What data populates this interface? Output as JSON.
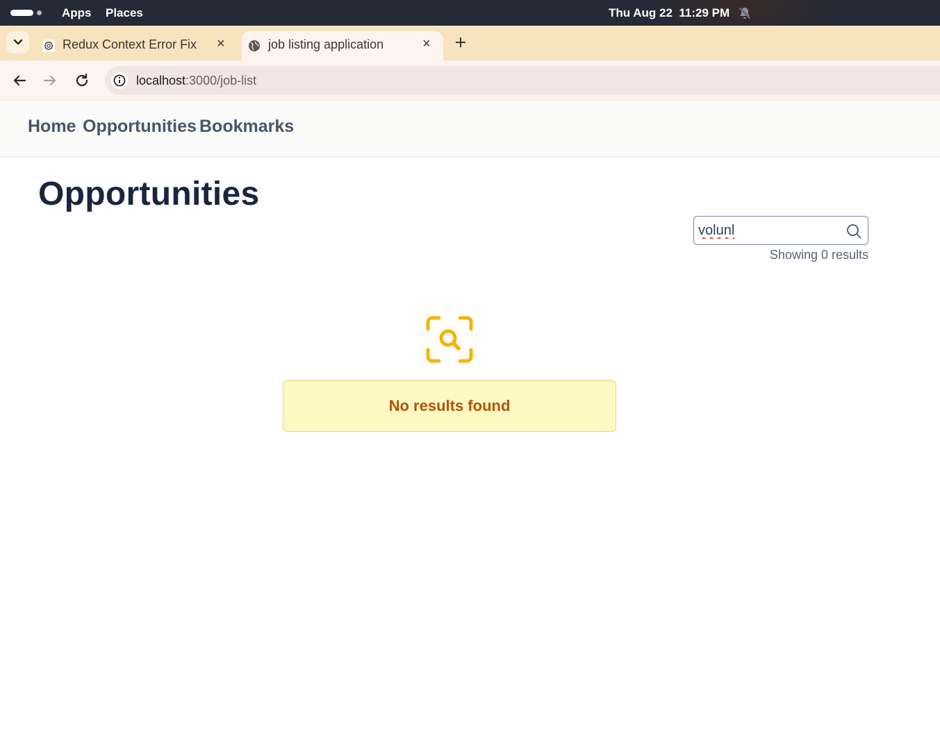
{
  "system_bar": {
    "menu_apps": "Apps",
    "menu_places": "Places",
    "clock": "Thu Aug 22  11:29 PM",
    "notification_icon": "bell-muted-icon"
  },
  "browser": {
    "tabs": [
      {
        "title": "Redux Context Error Fix",
        "favicon": "openai-logo-icon",
        "active": false
      },
      {
        "title": "job listing application",
        "favicon": "globe-icon",
        "active": true
      }
    ],
    "url_host": "localhost",
    "url_path": ":3000/job-list"
  },
  "app_nav": {
    "items": [
      "Home",
      "Opportunities",
      "Bookmarks"
    ]
  },
  "main": {
    "title": "Opportunities",
    "search": {
      "value": "volunl",
      "placeholder": ""
    },
    "results_text": "Showing 0 results",
    "empty_message": "No results found"
  },
  "colors": {
    "accent_yellow": "#f5b400",
    "empty_bg": "#fef9c3",
    "empty_text": "#b45309",
    "title": "#1a2540"
  }
}
